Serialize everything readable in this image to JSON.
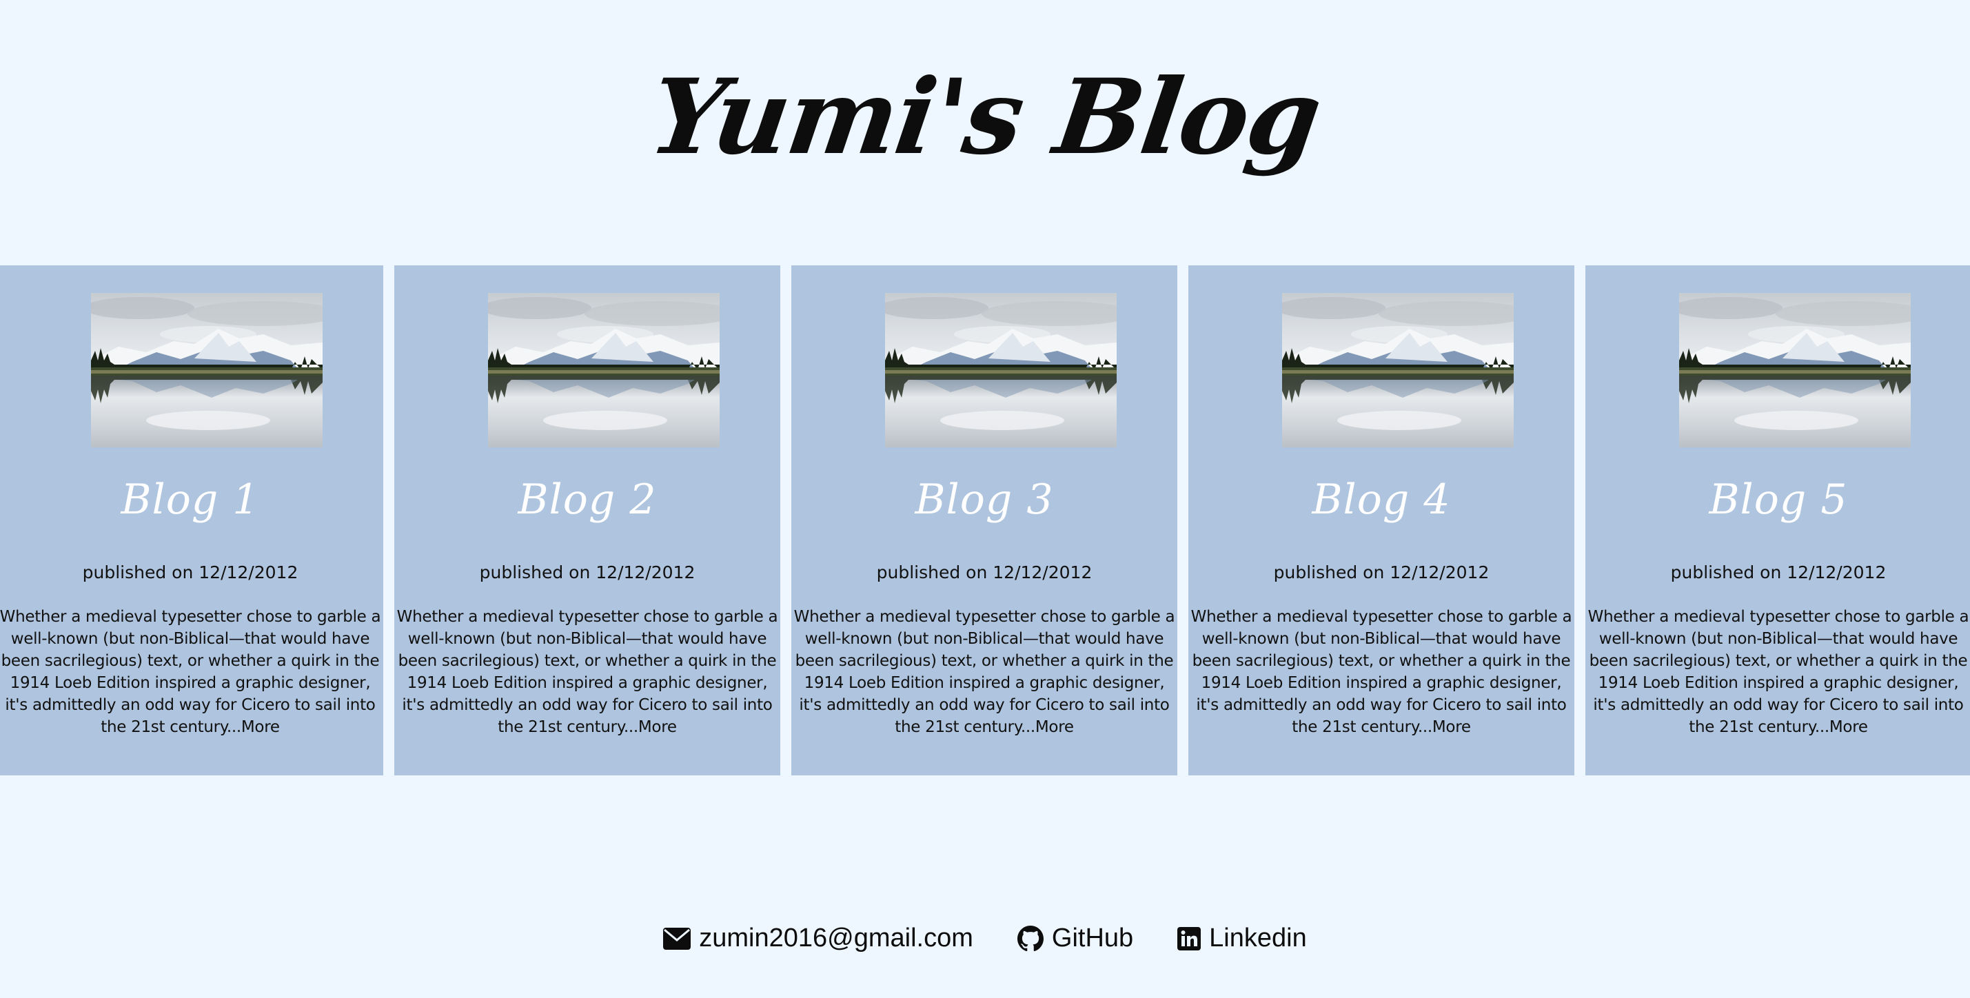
{
  "header": {
    "title": "Yumi's Blog"
  },
  "colors": {
    "page_background": "#eef6ff",
    "card_background": "#afc4de",
    "card_title": "#ffffff",
    "text": "#111111"
  },
  "blog_cards": [
    {
      "image_icon": "mountain-lake-photo",
      "title": "Blog 1",
      "date": "published on 12/12/2012",
      "excerpt": "Whether a medieval typesetter chose to garble a well-known (but non-Biblical—that would have been sacrilegious) text, or whether a quirk in the 1914 Loeb Edition inspired a graphic designer, it's admittedly an odd way for Cicero to sail into the 21st century...",
      "more_label": "More"
    },
    {
      "image_icon": "mountain-lake-photo",
      "title": "Blog 2",
      "date": "published on 12/12/2012",
      "excerpt": "Whether a medieval typesetter chose to garble a well-known (but non-Biblical—that would have been sacrilegious) text, or whether a quirk in the 1914 Loeb Edition inspired a graphic designer, it's admittedly an odd way for Cicero to sail into the 21st century...",
      "more_label": "More"
    },
    {
      "image_icon": "mountain-lake-photo",
      "title": "Blog 3",
      "date": "published on 12/12/2012",
      "excerpt": "Whether a medieval typesetter chose to garble a well-known (but non-Biblical—that would have been sacrilegious) text, or whether a quirk in the 1914 Loeb Edition inspired a graphic designer, it's admittedly an odd way for Cicero to sail into the 21st century...",
      "more_label": "More"
    },
    {
      "image_icon": "mountain-lake-photo",
      "title": "Blog 4",
      "date": "published on 12/12/2012",
      "excerpt": "Whether a medieval typesetter chose to garble a well-known (but non-Biblical—that would have been sacrilegious) text, or whether a quirk in the 1914 Loeb Edition inspired a graphic designer, it's admittedly an odd way for Cicero to sail into the 21st century...",
      "more_label": "More"
    },
    {
      "image_icon": "mountain-lake-photo",
      "title": "Blog 5",
      "date": "published on 12/12/2012",
      "excerpt": "Whether a medieval typesetter chose to garble a well-known (but non-Biblical—that would have been sacrilegious) text, or whether a quirk in the 1914 Loeb Edition inspired a graphic designer, it's admittedly an odd way for Cicero to sail into the 21st century...",
      "more_label": "More"
    }
  ],
  "footer": {
    "email": {
      "icon": "envelope-icon",
      "label": "zumin2016@gmail.com"
    },
    "github": {
      "icon": "github-icon",
      "label": "GitHub"
    },
    "linkedin": {
      "icon": "linkedin-icon",
      "label": "Linkedin"
    }
  }
}
